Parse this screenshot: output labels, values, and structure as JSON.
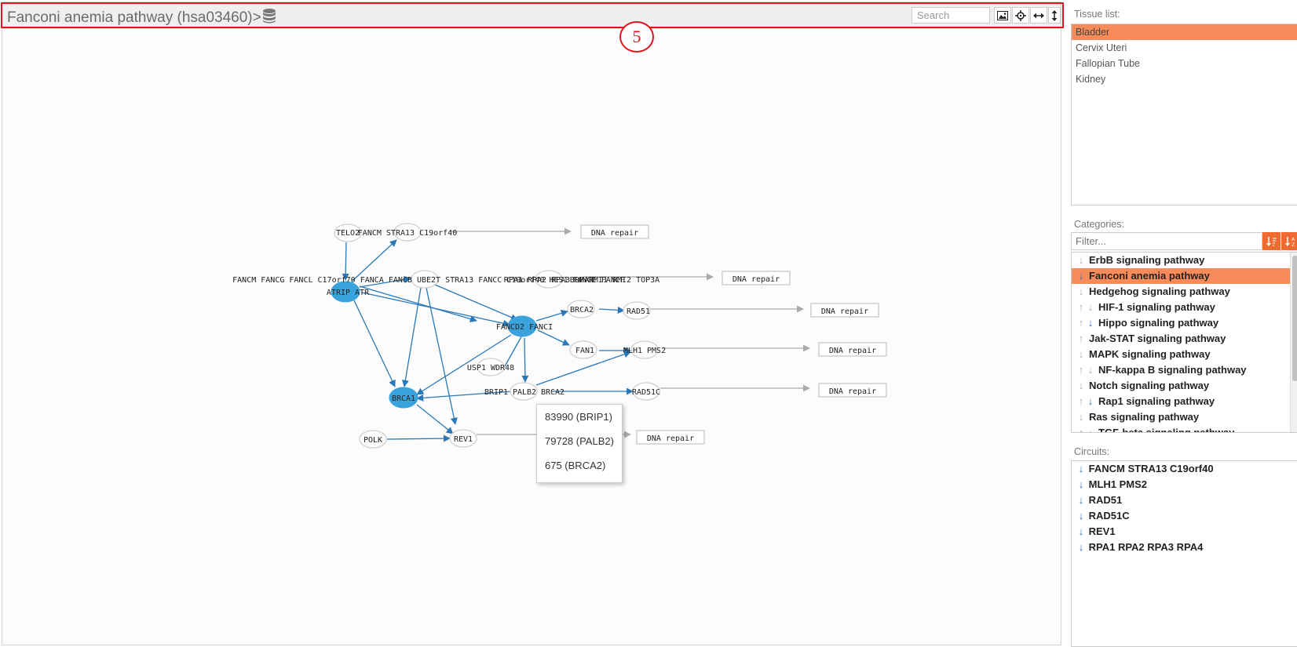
{
  "header": {
    "title": "Fanconi anemia pathway (hsa03460)>",
    "search_placeholder": "Search",
    "tools": [
      "image-icon",
      "crosshair-icon",
      "fit-width-icon",
      "fit-height-icon"
    ]
  },
  "annotation": {
    "step": "5"
  },
  "graph": {
    "nodes": {
      "telo2": "TELO2",
      "fancm_stra13": "FANCM STRA13 C19orf40",
      "fa_core": "FANCM FANCG FANCL C17orf70 FANCA FANCB UBE2T STRA13 FANCC C19orf40 HES1 FANCE FANCF",
      "rpa": "RPA1 RPA2 RPA3 RPA4",
      "blm": "BLM RMI1 RMI2 TOP3A",
      "atrip_atr": "ATRIP ATR",
      "fancd2_fanci": "FANCD2 FANCI",
      "brca2_top": "BRCA2",
      "rad51": "RAD51",
      "fan1": "FAN1",
      "mlh1_pms2": "MLH1 PMS2",
      "usp1_wdr48": "USP1 WDR48",
      "brca1": "BRCA1",
      "brip1": "BRIP1",
      "palb2": "PALB2",
      "brca2_bottom": "BRCA2",
      "rad51c": "RAD51C",
      "polk": "POLK",
      "rev1": "REV1"
    },
    "outputs": [
      "DNA repair",
      "DNA repair",
      "DNA repair",
      "DNA repair",
      "DNA repair",
      "DNA repair"
    ]
  },
  "tooltip": {
    "items": [
      "83990 (BRIP1)",
      "79728 (PALB2)",
      "675 (BRCA2)"
    ]
  },
  "sidebar": {
    "tissue_label": "Tissue list:",
    "tissues": [
      {
        "name": "Bladder",
        "selected": true
      },
      {
        "name": "Cervix Uteri",
        "selected": false
      },
      {
        "name": "Fallopian Tube",
        "selected": false
      },
      {
        "name": "Kidney",
        "selected": false
      }
    ],
    "categories_label": "Categories:",
    "filter_placeholder": "Filter...",
    "sort_buttons": [
      "sort-asc-icon",
      "sort-alpha-icon"
    ],
    "categories": [
      {
        "name": "ErbB signaling pathway",
        "arrows": [
          "down-grey"
        ],
        "selected": false
      },
      {
        "name": "Fanconi anemia pathway",
        "arrows": [
          "down-blue"
        ],
        "selected": true
      },
      {
        "name": "Hedgehog signaling pathway",
        "arrows": [
          "down-grey"
        ],
        "selected": false
      },
      {
        "name": "HIF-1 signaling pathway",
        "arrows": [
          "up-grey",
          "down-grey"
        ],
        "selected": false
      },
      {
        "name": "Hippo signaling pathway",
        "arrows": [
          "up-grey",
          "down-blue"
        ],
        "selected": false
      },
      {
        "name": "Jak-STAT signaling pathway",
        "arrows": [
          "up-grey"
        ],
        "selected": false
      },
      {
        "name": "MAPK signaling pathway",
        "arrows": [
          "down-grey"
        ],
        "selected": false
      },
      {
        "name": "NF-kappa B signaling pathway",
        "arrows": [
          "up-grey",
          "down-grey"
        ],
        "selected": false
      },
      {
        "name": "Notch signaling pathway",
        "arrows": [
          "down-grey"
        ],
        "selected": false
      },
      {
        "name": "Rap1 signaling pathway",
        "arrows": [
          "up-grey",
          "down-blue"
        ],
        "selected": false
      },
      {
        "name": "Ras signaling pathway",
        "arrows": [
          "down-grey"
        ],
        "selected": false
      },
      {
        "name": "TGF-beta signaling pathway",
        "arrows": [
          "up-grey",
          "down-grey"
        ],
        "selected": false
      }
    ],
    "circuits_label": "Circuits:",
    "circuits": [
      "FANCM STRA13 C19orf40",
      "MLH1 PMS2",
      "RAD51",
      "RAD51C",
      "REV1",
      "RPA1 RPA2 RPA3 RPA4"
    ]
  },
  "colors": {
    "accent": "#f78c5a",
    "node_active": "#3ba3dc",
    "edge": "#2a78b8",
    "highlight": "#e0141e"
  }
}
